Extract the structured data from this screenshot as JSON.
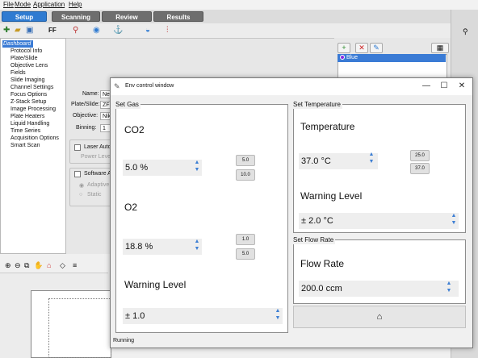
{
  "menu": [
    "File",
    "Mode",
    "Application",
    "Help"
  ],
  "main_tabs": [
    {
      "label": "Setup",
      "active": true
    },
    {
      "label": "Scanning",
      "active": false
    },
    {
      "label": "Review",
      "active": false
    },
    {
      "label": "Results",
      "active": false
    }
  ],
  "toolbar_icons": [
    "new-file-icon",
    "open-folder-icon",
    "save-icon",
    "focus-icon",
    "temperature-icon",
    "objective-icon",
    "microscope-icon",
    "flask-icon",
    "thermometer-icon"
  ],
  "sidebar": {
    "root": "Dashboard",
    "items": [
      "Protocol Info",
      "Plate/Slide",
      "Objective Lens",
      "Fields",
      "Slide Imaging",
      "Channel Settings",
      "Focus Options",
      "Z-Stack Setup",
      "Image Processing",
      "Plate Heaters",
      "Liquid Handling",
      "Time Series",
      "Acquisition Options",
      "Smart Scan"
    ]
  },
  "main_form": {
    "name_label": "Name:",
    "name_value": "New",
    "plate_label": "Plate/Slide:",
    "plate_value": "ZF",
    "objective_label": "Objective:",
    "objective_value": "Nik",
    "binning_label": "Binning:",
    "binning_value": "1 X",
    "laser_label": "Laser Auto",
    "power_label": "Power Level",
    "software_label": "Software Au",
    "adaptive_label": "Adaptive",
    "static_label": "Static"
  },
  "channel_list": {
    "selected_item": "Blue"
  },
  "env_window": {
    "title": "Env control window",
    "gas": {
      "legend": "Set Gas",
      "co2_label": "CO2",
      "co2_value": "5.0 %",
      "co2_presets": [
        "5.0",
        "10.0"
      ],
      "o2_label": "O2",
      "o2_value": "18.8 %",
      "o2_presets": [
        "1.0",
        "5.0"
      ],
      "warning_label": "Warning Level",
      "warning_value": "± 1.0"
    },
    "temperature": {
      "legend": "Set Temperature",
      "label": "Temperature",
      "value": "37.0 °C",
      "presets": [
        "25.0",
        "37.0"
      ],
      "warning_label": "Warning Level",
      "warning_value": "± 2.0 °C"
    },
    "flow": {
      "legend": "Set Flow Rate",
      "label": "Flow Rate",
      "value": "200.0 ccm"
    },
    "status": "Running"
  },
  "colors": {
    "accent": "#2f7bd1",
    "spin_arrow": "#3d7fd4",
    "window_bg": "#f0f0f0"
  }
}
